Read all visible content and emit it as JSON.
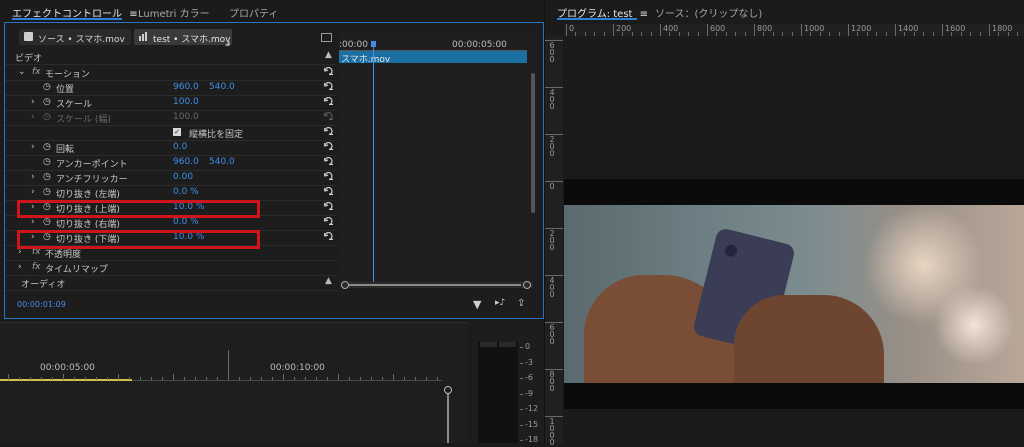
{
  "left_tabs": {
    "effect_controls": "エフェクトコントロール",
    "menu_glyph": "≡",
    "lumetri": "Lumetri カラー",
    "properties": "プロパティ"
  },
  "clip_selector": {
    "source": "ソース • スマホ.mov",
    "sequence": "test • スマホ.mov"
  },
  "mini_timeline": {
    "tc_start": ":00:00",
    "tc_end": "00:00:05:00",
    "clip_name": "スマホ.mov"
  },
  "sections": {
    "video": "ビデオ",
    "audio": "オーディオ"
  },
  "effects": {
    "motion": {
      "fx": "fx",
      "label": "モーション"
    },
    "position": {
      "label": "位置",
      "x": "960.0",
      "y": "540.0"
    },
    "scale": {
      "label": "スケール",
      "value": "100.0"
    },
    "scale_width": {
      "label": "スケール (幅)",
      "value": "100.0"
    },
    "uniform_scale": {
      "label": "縦横比を固定",
      "checked": true
    },
    "rotation": {
      "label": "回転",
      "value": "0.0"
    },
    "anchor": {
      "label": "アンカーポイント",
      "x": "960.0",
      "y": "540.0"
    },
    "antiflicker": {
      "label": "アンチフリッカー",
      "value": "0.00"
    },
    "crop_left": {
      "label": "切り抜き (左端)",
      "value": "0.0 %"
    },
    "crop_top": {
      "label": "切り抜き (上端)",
      "value": "10.0 %"
    },
    "crop_right": {
      "label": "切り抜き (右端)",
      "value": "0.0 %"
    },
    "crop_bottom": {
      "label": "切り抜き (下端)",
      "value": "10.0 %"
    },
    "opacity": {
      "fx": "fx",
      "label": "不透明度"
    },
    "time_remap": {
      "fx": "fx",
      "label": "タイムリマップ"
    }
  },
  "footer": {
    "timecode": "00:00:01:09"
  },
  "program_monitor": {
    "tab": "プログラム: test",
    "menu_glyph": "≡",
    "source_tab": "ソース：(クリップなし)",
    "ruler_labels": [
      "0",
      "200",
      "400",
      "600",
      "800",
      "1000",
      "1200",
      "1400",
      "1600",
      "1800"
    ],
    "vruler_labels": [
      "600",
      "400",
      "200",
      "0",
      "200",
      "400",
      "600",
      "800",
      "1000"
    ]
  },
  "timeline": {
    "tc1": "00:00:05:00",
    "tc2": "00:00:10:00"
  },
  "audio_meter": {
    "labels": [
      "0",
      "-3",
      "-6",
      "-9",
      "-12",
      "-15",
      "-18"
    ]
  },
  "colors": {
    "accent": "#2e7fd6",
    "value_blue": "#3f8ee8",
    "highlight": "#d0141b",
    "clip_bar": "#1b6fa3",
    "work_area": "#d4c14a"
  }
}
